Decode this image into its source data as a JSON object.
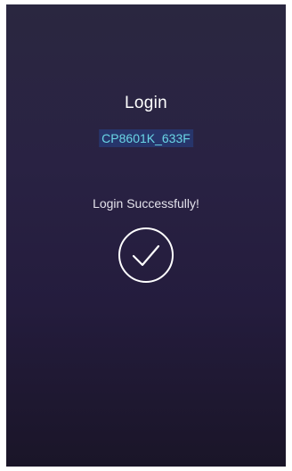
{
  "header": {
    "title": "Login",
    "device_name": "CP8601K_633F"
  },
  "status": {
    "message": "Login Successfully!",
    "icon": "checkmark-circle-icon"
  },
  "colors": {
    "background_top": "#2a2740",
    "background_bottom": "#1a1528",
    "device_name_text": "#6ad6e6",
    "device_name_highlight": "#27356b",
    "text": "#ffffff"
  }
}
